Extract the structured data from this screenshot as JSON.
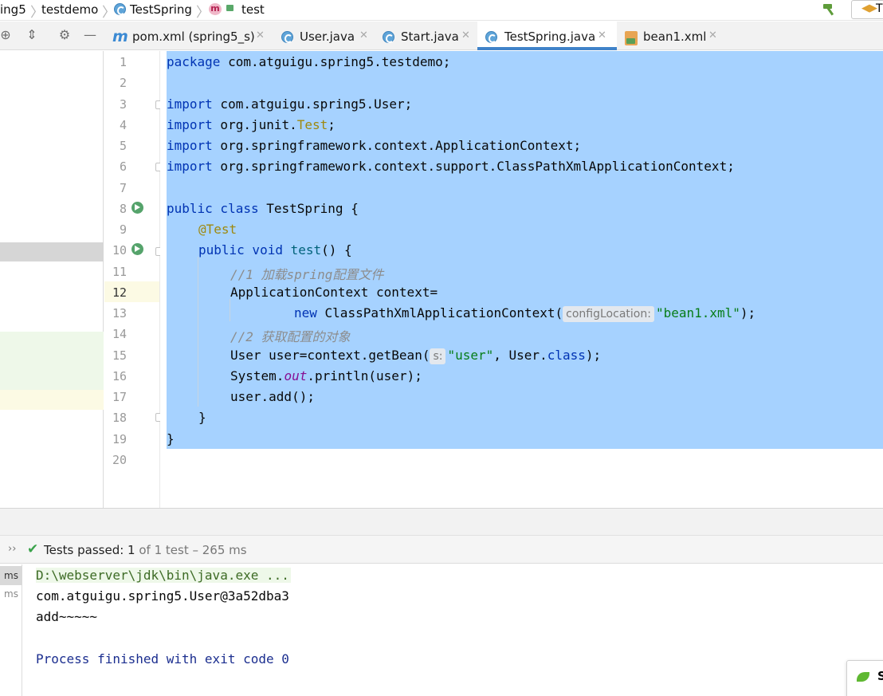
{
  "breadcrumb": {
    "items": [
      "ing5",
      "testdemo",
      "TestSpring",
      "test"
    ],
    "run_config_label": "T"
  },
  "tabs": [
    {
      "label": "pom.xml (spring5_s)",
      "icon": "maven-icon"
    },
    {
      "label": "User.java",
      "icon": "class-icon"
    },
    {
      "label": "Start.java",
      "icon": "class-icon"
    },
    {
      "label": "TestSpring.java",
      "icon": "class-icon",
      "active": true
    },
    {
      "label": "bean1.xml",
      "icon": "xml-icon"
    }
  ],
  "tool_icons": [
    "crosshair-icon",
    "collapse-icon",
    "gear-icon",
    "minimize-icon"
  ],
  "editor": {
    "line_numbers": [
      "1",
      "2",
      "3",
      "4",
      "5",
      "6",
      "7",
      "8",
      "9",
      "10",
      "11",
      "12",
      "13",
      "14",
      "15",
      "16",
      "17",
      "18",
      "19",
      "20"
    ],
    "current_line": "12",
    "code": {
      "l1_kw": "package",
      "l1_rest": " com.atguigu.spring5.testdemo;",
      "l3_kw": "import",
      "l3_rest": " com.atguigu.spring5.User;",
      "l4_kw": "import",
      "l4_rest": " org.junit.",
      "l4_ann": "Test",
      "l4_end": ";",
      "l5_kw": "import",
      "l5_rest": " org.springframework.context.ApplicationContext;",
      "l6_kw": "import",
      "l6_rest": " org.springframework.context.support.ClassPathXmlApplicationContext;",
      "l8_kw": "public class",
      "l8_rest": " TestSpring {",
      "l9_ann": "@Test",
      "l10_kw": "public void",
      "l10_name": " test",
      "l10_rest": "() {",
      "l11_cmt": "//1 加载spring配置文件",
      "l12": "ApplicationContext context=",
      "l13_kw": "new",
      "l13_rest": " ClassPathXmlApplicationContext(",
      "l13_hint": "configLocation:",
      "l13_str": "\"bean1.xml\"",
      "l13_end": ");",
      "l14_cmt": "//2 获取配置的对象",
      "l15_rest": "User user=context.getBean(",
      "l15_hint": "s:",
      "l15_str": "\"user\"",
      "l15_mid": ", User.",
      "l15_kw": "class",
      "l15_end": ");",
      "l16_a": "System.",
      "l16_fld": "out",
      "l16_b": ".println(user);",
      "l17": "user.add();",
      "l18": "}",
      "l19": "}"
    }
  },
  "run_panel": {
    "status_prefix": "Tests passed: ",
    "passed": "1",
    "status_suffix": " of 1 test – 265 ms",
    "tree_rows": [
      "ms",
      "ms"
    ],
    "console": [
      "D:\\webserver\\jdk\\bin\\java.exe ...",
      "com.atguigu.spring5.User@3a52dba3",
      "add~~~~~",
      "",
      "Process finished with exit code 0"
    ],
    "notification_letter": "S"
  },
  "colors": {
    "selection": "#a6d2ff",
    "keyword": "#0033b3",
    "annotation": "#9e880d",
    "string": "#067d17",
    "comment": "#8c8c8c",
    "active_tab_underline": "#4083c9",
    "pass_green": "#3aa24b"
  }
}
